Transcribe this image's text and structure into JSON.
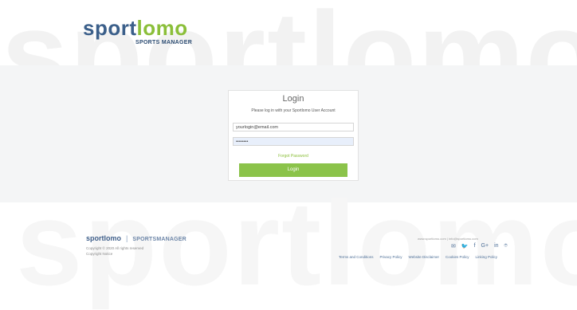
{
  "brand": {
    "logo_part1": "sport",
    "logo_part2": "lomo",
    "tagline": "SPORTS MANAGER",
    "bg_word": "sportlomo"
  },
  "login": {
    "title": "Login",
    "subtitle": "Please log in with your Sportlomo User Account",
    "email_value": "yourlogin@email.com",
    "password_value": "••••••••",
    "forgot_password": "Forgot Password",
    "login_button": "Login"
  },
  "footer": {
    "logo_left": "sportlomo",
    "logo_right": "SPORTSMANAGER",
    "separator": "|",
    "copyright": "Copyright © 2020 All rights reserved",
    "copyright_policy": "Copyright Notice",
    "contact": "www.sportlomo.com | info@sportlomo.com",
    "social_icons": [
      "email-icon",
      "twitter-icon",
      "facebook-icon",
      "google-plus-icon",
      "linkedin-icon",
      "instagram-icon"
    ],
    "social_glyphs": [
      "✉",
      "🐦",
      "f",
      "G+",
      "in",
      "⌾"
    ],
    "links": [
      "Terms and Conditions",
      "Privacy Policy",
      "Website Disclaimer",
      "Cookies Policy",
      "Linking Policy"
    ]
  }
}
